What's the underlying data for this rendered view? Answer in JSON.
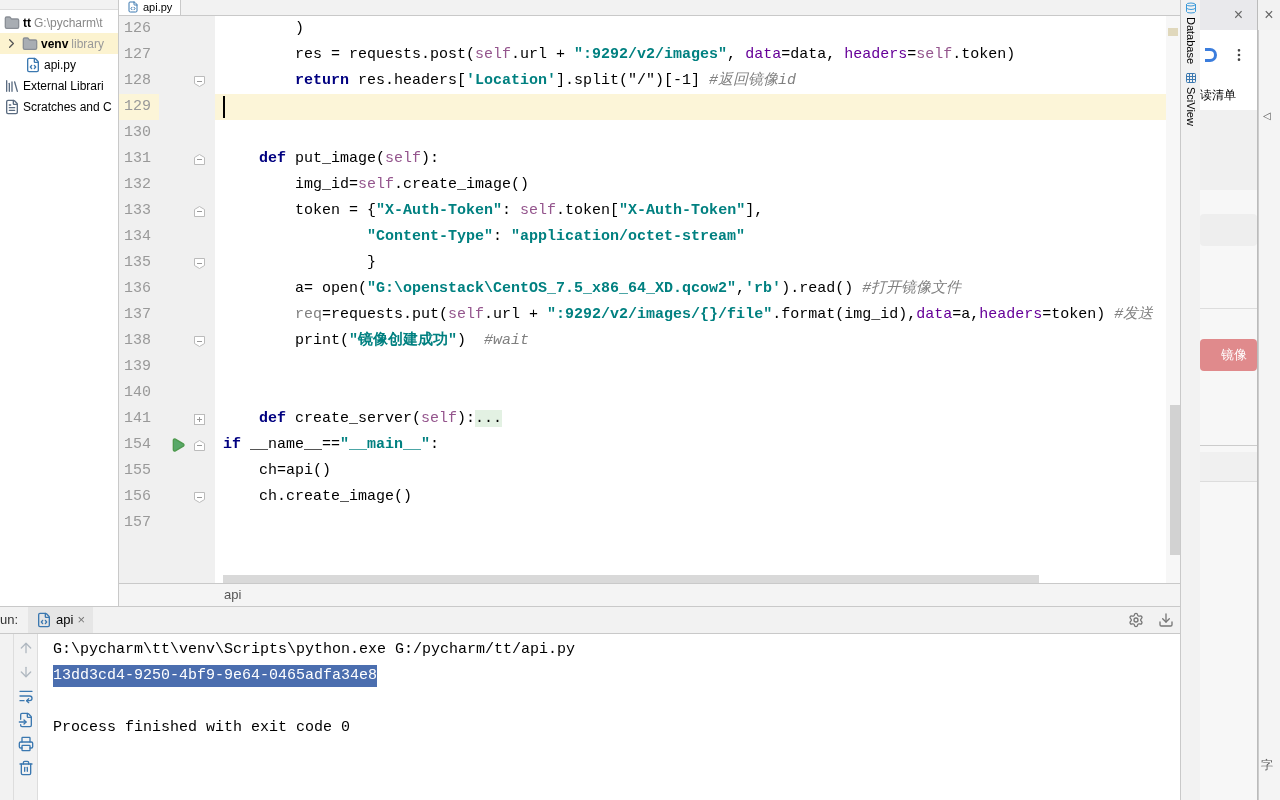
{
  "project_tree": [
    {
      "label": "tt",
      "path": "G:\\pycharm\\t",
      "kind": "folder",
      "selected": false,
      "children": [
        {
          "label": "venv",
          "note": "library",
          "kind": "folder",
          "expanded": false,
          "selected": true
        },
        {
          "label": "api.py",
          "kind": "python",
          "selected": false
        }
      ]
    },
    {
      "label": "External Librari",
      "kind": "libraries",
      "selected": false
    },
    {
      "label": "Scratches and C",
      "kind": "scratches",
      "selected": false
    }
  ],
  "editor": {
    "tab": {
      "label": "api.py"
    },
    "lines": [
      {
        "number": "126",
        "current": false,
        "run": false,
        "tokens": [
          {
            "kind": "plain",
            "text": "        )"
          }
        ]
      },
      {
        "number": "127",
        "current": false,
        "run": false,
        "tokens": [
          {
            "kind": "plain",
            "text": "        res = requests.post("
          },
          {
            "kind": "self",
            "text": "self"
          },
          {
            "kind": "plain",
            "text": ".url + "
          },
          {
            "kind": "str",
            "text": "\":9292/v2/images\""
          },
          {
            "kind": "plain",
            "text": ", "
          },
          {
            "kind": "param",
            "text": "data"
          },
          {
            "kind": "plain",
            "text": "=data, "
          },
          {
            "kind": "param",
            "text": "headers"
          },
          {
            "kind": "plain",
            "text": "="
          },
          {
            "kind": "self",
            "text": "self"
          },
          {
            "kind": "plain",
            "text": ".token)"
          }
        ]
      },
      {
        "number": "128",
        "current": false,
        "run": false,
        "fold": {
          "kind": "end"
        },
        "tokens": [
          {
            "kind": "kw",
            "text": "        return"
          },
          {
            "kind": "plain",
            "text": " res.headers["
          },
          {
            "kind": "str",
            "text": "'Location'"
          },
          {
            "kind": "plain",
            "text": "].split(\"/\")[-1] "
          },
          {
            "kind": "comment",
            "text": "#返回镜像id"
          }
        ]
      },
      {
        "number": "129",
        "current": true,
        "run": false
      },
      {
        "number": "130",
        "current": false,
        "run": false
      },
      {
        "number": "131",
        "current": false,
        "run": false,
        "fold": {
          "kind": "start"
        },
        "tokens": [
          {
            "kind": "kw",
            "text": "    def"
          },
          {
            "kind": "plain",
            "text": " put_image("
          },
          {
            "kind": "self",
            "text": "self"
          },
          {
            "kind": "plain",
            "text": "):"
          }
        ]
      },
      {
        "number": "132",
        "current": false,
        "run": false,
        "tokens": [
          {
            "kind": "plain",
            "text": "        img_id="
          },
          {
            "kind": "self",
            "text": "self"
          },
          {
            "kind": "plain",
            "text": ".create_image()"
          }
        ]
      },
      {
        "number": "133",
        "current": false,
        "run": false,
        "fold": {
          "kind": "start"
        },
        "tokens": [
          {
            "kind": "plain",
            "text": "        token = {"
          },
          {
            "kind": "str",
            "text": "\"X-Auth-Token\""
          },
          {
            "kind": "plain",
            "text": ": "
          },
          {
            "kind": "self",
            "text": "self"
          },
          {
            "kind": "plain",
            "text": ".token["
          },
          {
            "kind": "str",
            "text": "\"X-Auth-Token\""
          },
          {
            "kind": "plain",
            "text": "],"
          }
        ]
      },
      {
        "number": "134",
        "current": false,
        "run": false,
        "tokens": [
          {
            "kind": "str",
            "text": "                \"Content-Type\""
          },
          {
            "kind": "plain",
            "text": ": "
          },
          {
            "kind": "str",
            "text": "\"application/octet-stream\""
          }
        ]
      },
      {
        "number": "135",
        "current": false,
        "run": false,
        "fold": {
          "kind": "end"
        },
        "tokens": [
          {
            "kind": "plain",
            "text": "                }"
          }
        ]
      },
      {
        "number": "136",
        "current": false,
        "run": false,
        "tokens": [
          {
            "kind": "plain",
            "text": "        a= open("
          },
          {
            "kind": "str",
            "text": "\"G:\\openstack\\CentOS_7.5_x86_64_XD.qcow2\""
          },
          {
            "kind": "plain",
            "text": ","
          },
          {
            "kind": "str",
            "text": "'rb'"
          },
          {
            "kind": "plain",
            "text": ").read() "
          },
          {
            "kind": "comment",
            "text": "#打开镜像文件"
          }
        ]
      },
      {
        "number": "137",
        "current": false,
        "run": false,
        "tokens": [
          {
            "kind": "unused",
            "text": "        req"
          },
          {
            "kind": "plain",
            "text": "=requests.put("
          },
          {
            "kind": "self",
            "text": "self"
          },
          {
            "kind": "plain",
            "text": ".url + "
          },
          {
            "kind": "str",
            "text": "\":9292/v2/images/{}/file\""
          },
          {
            "kind": "plain",
            "text": ".format(img_id),"
          },
          {
            "kind": "param",
            "text": "data"
          },
          {
            "kind": "plain",
            "text": "=a,"
          },
          {
            "kind": "param",
            "text": "headers"
          },
          {
            "kind": "plain",
            "text": "=token) "
          },
          {
            "kind": "comment",
            "text": "#发送"
          }
        ]
      },
      {
        "number": "138",
        "current": false,
        "run": false,
        "fold": {
          "kind": "end"
        },
        "tokens": [
          {
            "kind": "plain",
            "text": "        print("
          },
          {
            "kind": "str",
            "text": "\"镜像创建成功\""
          },
          {
            "kind": "plain",
            "text": ")  "
          },
          {
            "kind": "comment",
            "text": "#wait"
          }
        ]
      },
      {
        "number": "139",
        "current": false,
        "run": false
      },
      {
        "number": "140",
        "current": false,
        "run": false
      },
      {
        "number": "141",
        "current": false,
        "run": false,
        "fold": {
          "kind": "collapsed"
        },
        "tokens": [
          {
            "kind": "kw",
            "text": "    def"
          },
          {
            "kind": "plain",
            "text": " create_server("
          },
          {
            "kind": "self",
            "text": "self"
          },
          {
            "kind": "plain",
            "text": "):"
          },
          {
            "kind": "folded",
            "text": "..."
          }
        ]
      },
      {
        "number": "154",
        "current": false,
        "run": true,
        "fold": {
          "kind": "start"
        },
        "tokens": [
          {
            "kind": "kw",
            "text": "if"
          },
          {
            "kind": "plain",
            "text": " __name__=="
          },
          {
            "kind": "str",
            "text": "\"__main__\""
          },
          {
            "kind": "plain",
            "text": ":"
          }
        ]
      },
      {
        "number": "155",
        "current": false,
        "run": false,
        "tokens": [
          {
            "kind": "plain",
            "text": "    ch=api()"
          }
        ]
      },
      {
        "number": "156",
        "current": false,
        "run": false,
        "fold": {
          "kind": "end"
        },
        "tokens": [
          {
            "kind": "plain",
            "text": "    ch.create_image()"
          }
        ]
      },
      {
        "number": "157",
        "current": false,
        "run": false
      }
    ],
    "breadcrumb": "api"
  },
  "run": {
    "label": "un:",
    "tab": {
      "label": "api",
      "close": "×"
    },
    "output": [
      {
        "text": "G:\\pycharm\\tt\\venv\\Scripts\\python.exe G:/pycharm/tt/api.py",
        "selected": false
      },
      {
        "text": "13dd3cd4-9250-4bf9-9e64-0465adfa34e8",
        "selected": true
      }
    ],
    "exit_message": "Process finished with exit code 0"
  },
  "side_tools": [
    {
      "label": "Database",
      "kind": "database"
    },
    {
      "label": "SciView",
      "kind": "sciview"
    }
  ],
  "browser": {
    "close": "×",
    "reading_list": "读清单",
    "button": "镜像",
    "back_close": "×",
    "back_arrow": "◁",
    "status": "字"
  }
}
